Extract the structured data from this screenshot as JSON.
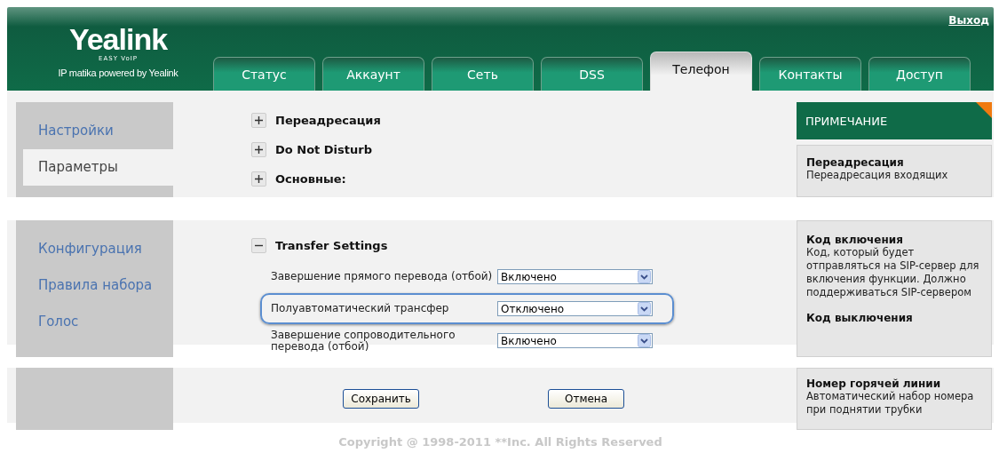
{
  "header": {
    "logo": "Yealink",
    "tagline": "EASY VoIP",
    "subtitle": "IP matika powered by Yealink",
    "logout": "Выход"
  },
  "tabs": [
    {
      "label": "Статус",
      "selected": false
    },
    {
      "label": "Аккаунт",
      "selected": false
    },
    {
      "label": "Сеть",
      "selected": false
    },
    {
      "label": "DSS",
      "selected": false
    },
    {
      "label": "Телефон",
      "selected": true
    },
    {
      "label": "Контакты",
      "selected": false
    },
    {
      "label": "Доступ",
      "selected": false
    }
  ],
  "bands": [
    {
      "sidebar": [
        {
          "label": "Настройки",
          "selected": false
        },
        {
          "label": "Параметры",
          "selected": true
        }
      ],
      "sections": [
        {
          "title": "Переадресация",
          "expanded": false
        },
        {
          "title": "Do Not Disturb",
          "expanded": false
        },
        {
          "title": "Основные:",
          "expanded": false
        }
      ],
      "notes_title": "ПРИМЕЧАНИЕ",
      "notes": [
        {
          "title": "Переадресация",
          "text": "Переадресация входящих"
        }
      ]
    },
    {
      "sidebar": [
        {
          "label": "Конфигурация",
          "selected": false
        },
        {
          "label": "Правила набора",
          "selected": false
        },
        {
          "label": "Голос",
          "selected": false
        }
      ],
      "sections": [
        {
          "title": "Transfer Settings",
          "expanded": true
        }
      ],
      "fields": [
        {
          "label": "Завершение прямого перевода (отбой)",
          "value": "Включено",
          "highlighted": false
        },
        {
          "label": "Полуавтоматический трансфер",
          "value": "Отключено",
          "highlighted": true
        },
        {
          "label": "Завершение сопроводительного перевода (отбой)",
          "value": "Включено",
          "highlighted": false
        }
      ],
      "notes": [
        {
          "title": "Код включения",
          "text": "Код, который будет отправляться на SIP-сервер для включения функции. Должно поддерживаться SIP-сервером"
        },
        {
          "title": "Код выключения"
        }
      ]
    },
    {
      "buttons": [
        "Сохранить",
        "Отмена"
      ],
      "notes": [
        {
          "title": "Номер горячей линии",
          "text": "Автоматический набор номера при поднятии трубки"
        }
      ]
    }
  ],
  "footer": "Copyright @ 1998-2011 **Inc. All Rights Reserved"
}
